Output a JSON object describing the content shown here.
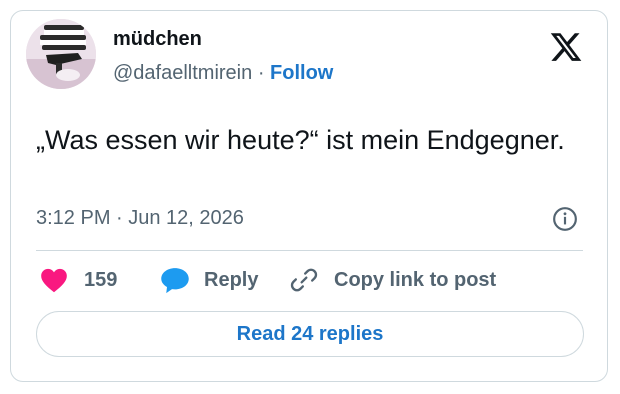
{
  "author": {
    "display_name": "müdchen",
    "handle": "@dafaelltmirein",
    "separator": "·",
    "follow_label": "Follow",
    "avatar_icon": "profile-avatar"
  },
  "tweet": {
    "text": "„Was essen wir heute?“ ist mein Endgegner.",
    "timestamp": "3:12 PM · Jun 12, 2026"
  },
  "actions": {
    "like_count": "159",
    "reply_label": "Reply",
    "copy_label": "Copy link to post"
  },
  "read_replies_label": "Read 24 replies",
  "icons": {
    "brand": "x-logo-icon",
    "info": "info-icon",
    "like": "heart-icon",
    "reply": "speech-bubble-icon",
    "copy": "link-icon"
  },
  "colors": {
    "accent_blue": "#1d76c9",
    "heart_pink": "#f91880",
    "reply_blue": "#1d9bf0",
    "muted_text": "#536471",
    "border": "#cfd9de"
  }
}
